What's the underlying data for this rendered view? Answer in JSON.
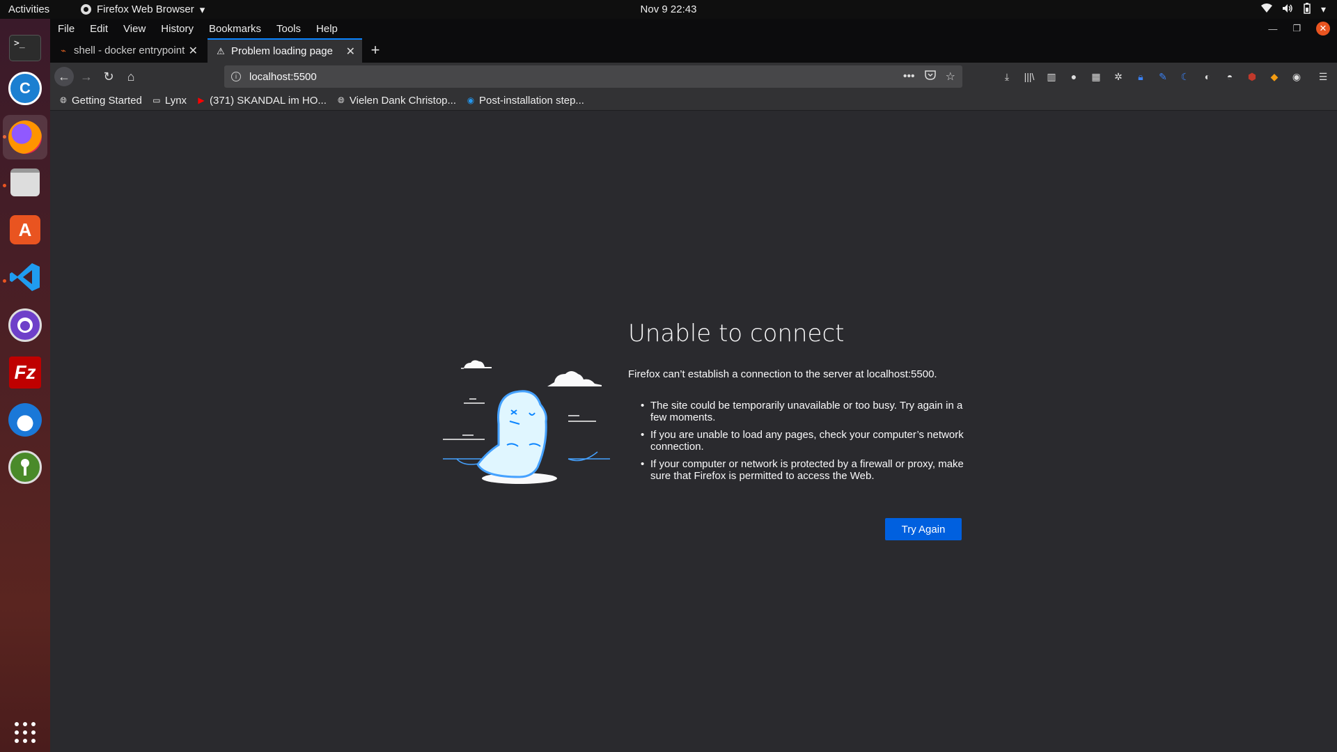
{
  "topbar": {
    "activities": "Activities",
    "app_name": "Firefox Web Browser",
    "clock": "Nov 9  22:43"
  },
  "dock": {
    "items": [
      {
        "name": "terminal",
        "label": ">_"
      },
      {
        "name": "ccleaner",
        "label": "C"
      },
      {
        "name": "firefox",
        "label": ""
      },
      {
        "name": "files",
        "label": ""
      },
      {
        "name": "app-center",
        "label": "A"
      },
      {
        "name": "vscode",
        "label": "≺"
      },
      {
        "name": "github-desktop",
        "label": ""
      },
      {
        "name": "filezilla",
        "label": "Fz"
      },
      {
        "name": "thunderbird",
        "label": ""
      },
      {
        "name": "keepassxc",
        "label": ""
      }
    ]
  },
  "menubar": {
    "items": [
      "File",
      "Edit",
      "View",
      "History",
      "Bookmarks",
      "Tools",
      "Help"
    ]
  },
  "tabs": [
    {
      "title": "shell - docker entrypoint",
      "close": "✕"
    },
    {
      "title": "Problem loading page",
      "close": "✕"
    }
  ],
  "newtab_label": "+",
  "navbar": {
    "url": "localhost:5500",
    "back": "←",
    "forward": "→",
    "reload": "↻",
    "home": "⌂",
    "page_actions": "•••",
    "menu": "☰"
  },
  "bookmarks": [
    {
      "label": "Getting Started",
      "icon": "globe-icon"
    },
    {
      "label": "Lynx",
      "icon": "folder-icon"
    },
    {
      "label": "(371) SKANDAL im HO...",
      "icon": "youtube-icon"
    },
    {
      "label": "Vielen Dank Christop...",
      "icon": "globe-icon"
    },
    {
      "label": "Post-installation step...",
      "icon": "docker-icon"
    }
  ],
  "error": {
    "title": "Unable to connect",
    "description": "Firefox can’t establish a connection to the server at localhost:5500.",
    "bullets": [
      "The site could be temporarily unavailable or too busy. Try again in a few moments.",
      "If you are unable to load any pages, check your computer’s network connection.",
      "If your computer or network is protected by a firewall or proxy, make sure that Firefox is permitted to access the Web."
    ],
    "button": "Try Again"
  },
  "colors": {
    "accent": "#0a84ff",
    "button": "#0060df",
    "content_bg": "#2a2a2e",
    "ubuntu_orange": "#e95420"
  }
}
